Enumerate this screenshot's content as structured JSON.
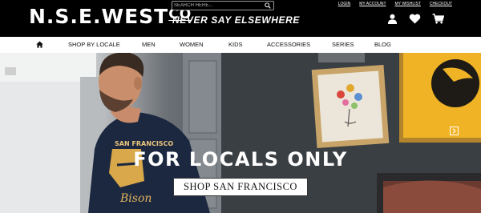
{
  "header": {
    "logo_main": "N.S.E.WEST",
    "logo_co": "CO",
    "search_placeholder": "SEARCH HERE...",
    "tagline": "NEVER SAY ELSEWHERE",
    "links": {
      "login": "LOGIN",
      "my_account": "MY ACCOUNT",
      "my_wishlist": "MY WISHLIST",
      "checkout": "CHECKOUT"
    },
    "icons": [
      "user-icon",
      "heart-icon",
      "cart-icon"
    ]
  },
  "nav": {
    "home_icon": "home-icon",
    "items": [
      {
        "label": "SHOP BY LOCALE"
      },
      {
        "label": "MEN"
      },
      {
        "label": "WOMEN"
      },
      {
        "label": "KIDS"
      },
      {
        "label": "ACCESSORIES"
      },
      {
        "label": "SERIES"
      },
      {
        "label": "BLOG"
      }
    ]
  },
  "hero": {
    "headline": "FOR LOCALS ONLY",
    "cta_label": "SHOP SAN FRANCISCO",
    "next_icon": "chevron-right-icon"
  },
  "colors": {
    "header_bg": "#000000",
    "nav_bg": "#ffffff",
    "text_dark": "#111111"
  }
}
